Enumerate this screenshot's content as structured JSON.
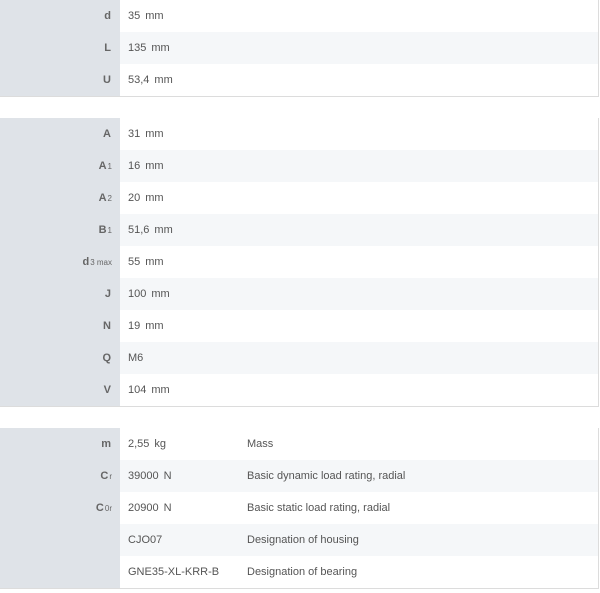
{
  "dimensions": [
    {
      "sym": "d",
      "sub": "",
      "value": "35",
      "unit": "mm"
    },
    {
      "sym": "L",
      "sub": "",
      "value": "135",
      "unit": "mm"
    },
    {
      "sym": "U",
      "sub": "",
      "value": "53,4",
      "unit": "mm"
    }
  ],
  "mounting": [
    {
      "sym": "A",
      "sub": "",
      "value": "31",
      "unit": "mm"
    },
    {
      "sym": "A",
      "sub": "1",
      "value": "16",
      "unit": "mm"
    },
    {
      "sym": "A",
      "sub": "2",
      "value": "20",
      "unit": "mm"
    },
    {
      "sym": "B",
      "sub": "1",
      "value": "51,6",
      "unit": "mm"
    },
    {
      "sym": "d",
      "sub": "3 max",
      "value": "55",
      "unit": "mm"
    },
    {
      "sym": "J",
      "sub": "",
      "value": "100",
      "unit": "mm"
    },
    {
      "sym": "N",
      "sub": "",
      "value": "19",
      "unit": "mm"
    },
    {
      "sym": "Q",
      "sub": "",
      "value": "M6",
      "unit": ""
    },
    {
      "sym": "V",
      "sub": "",
      "value": "104",
      "unit": "mm"
    }
  ],
  "properties": [
    {
      "sym": "m",
      "sub": "",
      "value": "2,55",
      "unit": "kg",
      "desc": "Mass"
    },
    {
      "sym": "C",
      "sub": "r",
      "value": "39000",
      "unit": "N",
      "desc": "Basic dynamic load rating, radial"
    },
    {
      "sym": "C",
      "sub": "0r",
      "value": "20900",
      "unit": "N",
      "desc": "Basic static load rating, radial"
    },
    {
      "sym": "",
      "sub": "",
      "value": "CJO07",
      "unit": "",
      "desc": "Designation of housing"
    },
    {
      "sym": "",
      "sub": "",
      "value": "GNE35-XL-KRR-B",
      "unit": "",
      "desc": "Designation of bearing"
    }
  ]
}
